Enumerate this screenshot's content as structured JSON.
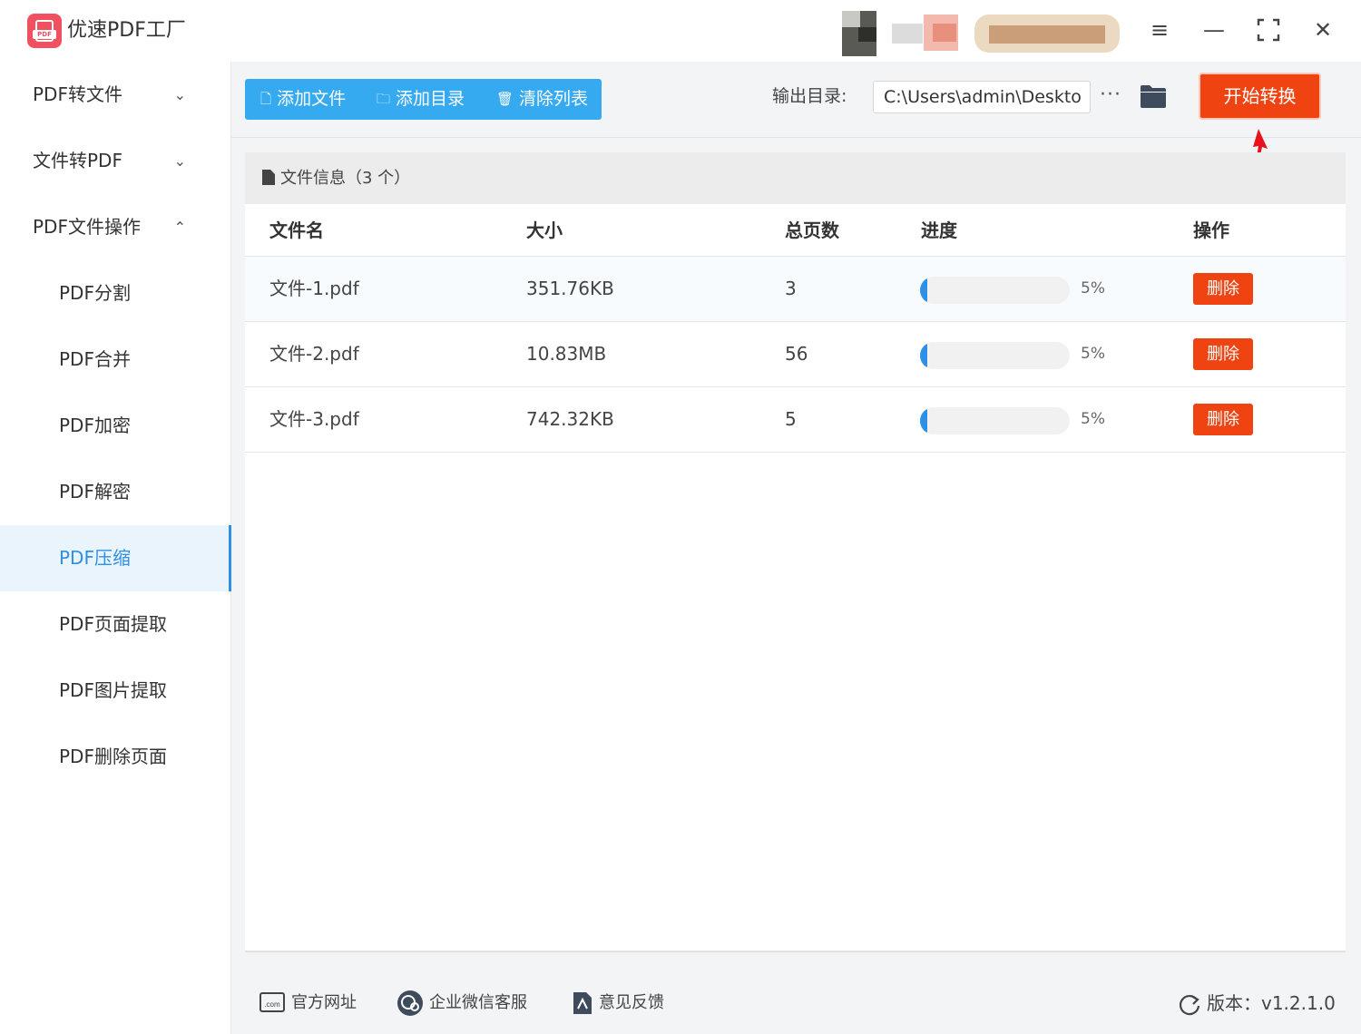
{
  "app": {
    "title": "优速PDF工厂",
    "logo_text": "PDF"
  },
  "window_controls": {
    "menu": "≡",
    "minimize": "—",
    "fullscreen": "⛶",
    "close": "✕"
  },
  "sidebar": {
    "groups": [
      {
        "label": "PDF转文件",
        "chevron": "⌄"
      },
      {
        "label": "文件转PDF",
        "chevron": "⌄"
      },
      {
        "label": "PDF文件操作",
        "chevron": "⌃"
      }
    ],
    "items": [
      {
        "label": "PDF分割"
      },
      {
        "label": "PDF合并"
      },
      {
        "label": "PDF加密"
      },
      {
        "label": "PDF解密"
      },
      {
        "label": "PDF压缩"
      },
      {
        "label": "PDF页面提取"
      },
      {
        "label": "PDF图片提取"
      },
      {
        "label": "PDF删除页面"
      }
    ],
    "active_item": "PDF压缩"
  },
  "toolbar": {
    "add_file": "添加文件",
    "add_folder": "添加目录",
    "clear_list": "清除列表",
    "output_label": "输出目录:",
    "output_path": "C:\\Users\\admin\\Deskto",
    "more": "···",
    "start": "开始转换"
  },
  "file_panel": {
    "header": "文件信息（3 个）",
    "columns": [
      "文件名",
      "大小",
      "总页数",
      "进度",
      "操作"
    ],
    "rows": [
      {
        "name": "文件-1.pdf",
        "size": "351.76KB",
        "pages": "3",
        "progress": 5,
        "progress_text": "5%",
        "action": "删除"
      },
      {
        "name": "文件-2.pdf",
        "size": "10.83MB",
        "pages": "56",
        "progress": 5,
        "progress_text": "5%",
        "action": "删除"
      },
      {
        "name": "文件-3.pdf",
        "size": "742.32KB",
        "pages": "5",
        "progress": 5,
        "progress_text": "5%",
        "action": "删除"
      }
    ]
  },
  "footer": {
    "website": "官方网址",
    "wechat": "企业微信客服",
    "feedback": "意见反馈",
    "version": "版本：v1.2.1.0",
    "website_icon_text": ".com"
  },
  "colors": {
    "accent_blue": "#36aaf0",
    "active_blue": "#2e8fe6",
    "danger": "#f04312",
    "logo": "#f0505f"
  }
}
